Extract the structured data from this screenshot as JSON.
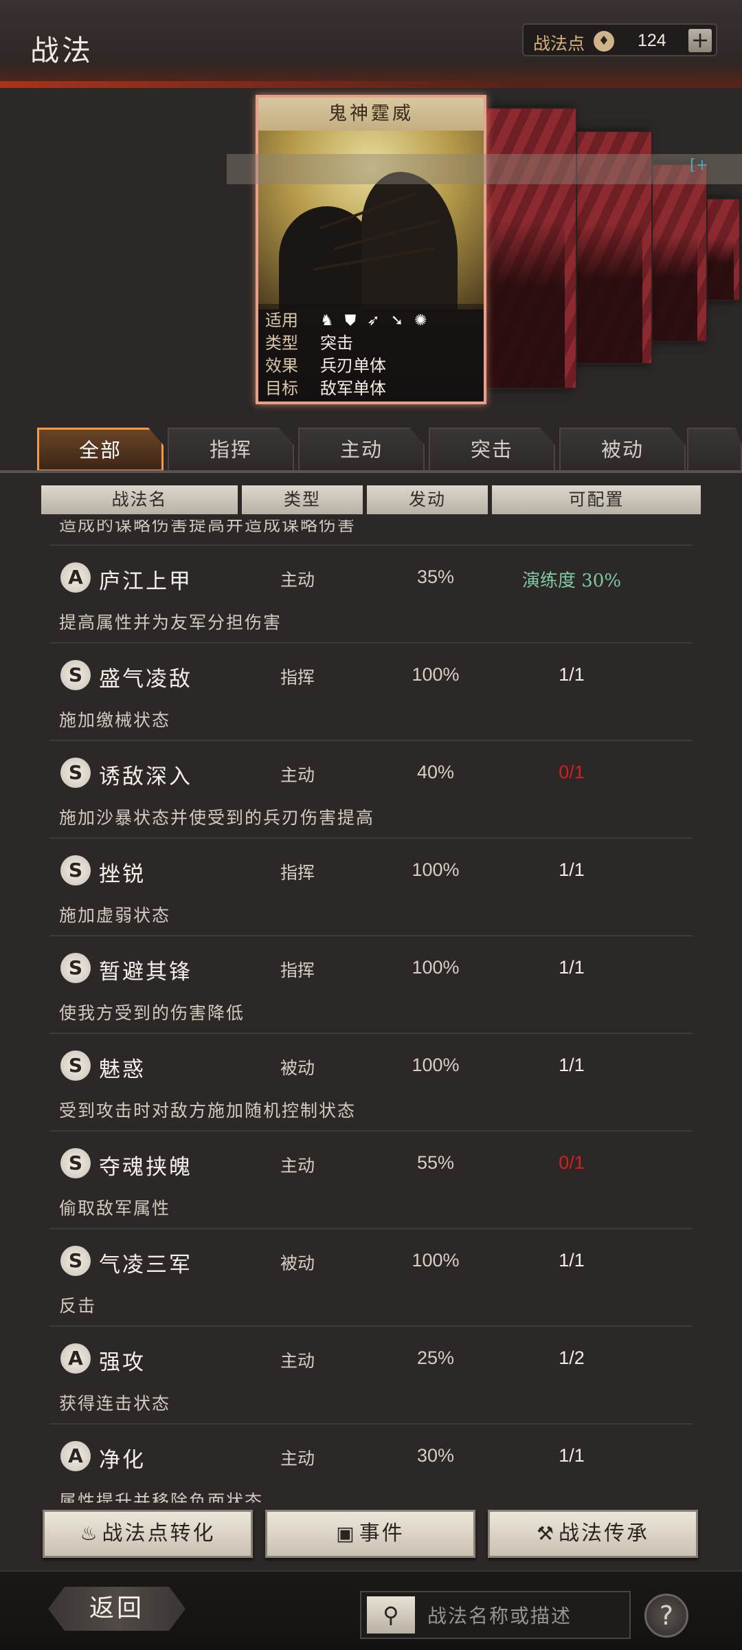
{
  "header": {
    "title": "战法",
    "points_label": "战法点",
    "points_value": "124",
    "plus_label": "+"
  },
  "card": {
    "name": "鬼神霆威",
    "rows": [
      {
        "key": "适用",
        "value": ""
      },
      {
        "key": "类型",
        "value": "突击"
      },
      {
        "key": "效果",
        "value": "兵刃单体"
      },
      {
        "key": "目标",
        "value": "敌军单体"
      }
    ],
    "troop_icons": [
      "cavalry-icon",
      "shield-icon",
      "bow-icon",
      "spear-icon",
      "siege-icon"
    ],
    "scroll_marker": "[+"
  },
  "tabs": [
    {
      "label": "全部",
      "active": true
    },
    {
      "label": "指挥",
      "active": false
    },
    {
      "label": "主动",
      "active": false
    },
    {
      "label": "突击",
      "active": false
    },
    {
      "label": "被动",
      "active": false
    }
  ],
  "columns": [
    "战法名",
    "类型",
    "发动",
    "可配置"
  ],
  "cut_text": "造成的谋略伤害提高并造成谋略伤害",
  "skills": [
    {
      "grade": "A",
      "name": "庐江上甲",
      "type": "主动",
      "rate": "35%",
      "config": "演练度 30%",
      "config_style": "green",
      "desc": "提高属性并为友军分担伤害"
    },
    {
      "grade": "S",
      "name": "盛气凌敌",
      "type": "指挥",
      "rate": "100%",
      "config": "1/1",
      "config_style": "normal",
      "desc": "施加缴械状态"
    },
    {
      "grade": "S",
      "name": "诱敌深入",
      "type": "主动",
      "rate": "40%",
      "config": "0/1",
      "config_style": "red",
      "desc": "施加沙暴状态并使受到的兵刃伤害提高"
    },
    {
      "grade": "S",
      "name": "挫锐",
      "type": "指挥",
      "rate": "100%",
      "config": "1/1",
      "config_style": "normal",
      "desc": "施加虚弱状态"
    },
    {
      "grade": "S",
      "name": "暂避其锋",
      "type": "指挥",
      "rate": "100%",
      "config": "1/1",
      "config_style": "normal",
      "desc": "使我方受到的伤害降低"
    },
    {
      "grade": "S",
      "name": "魅惑",
      "type": "被动",
      "rate": "100%",
      "config": "1/1",
      "config_style": "normal",
      "desc": "受到攻击时对敌方施加随机控制状态"
    },
    {
      "grade": "S",
      "name": "夺魂挟魄",
      "type": "主动",
      "rate": "55%",
      "config": "0/1",
      "config_style": "red",
      "desc": "偷取敌军属性"
    },
    {
      "grade": "S",
      "name": "气凌三军",
      "type": "被动",
      "rate": "100%",
      "config": "1/1",
      "config_style": "normal",
      "desc": "反击"
    },
    {
      "grade": "A",
      "name": "强攻",
      "type": "主动",
      "rate": "25%",
      "config": "1/2",
      "config_style": "normal",
      "desc": "获得连击状态"
    },
    {
      "grade": "A",
      "name": "净化",
      "type": "主动",
      "rate": "30%",
      "config": "1/1",
      "config_style": "normal",
      "desc": "属性提升并移除负面状态"
    }
  ],
  "bottom_buttons": [
    {
      "icon": "flame-icon",
      "label": "战法点转化"
    },
    {
      "icon": "event-icon",
      "label": "事件"
    },
    {
      "icon": "hammer-icon",
      "label": "战法传承"
    }
  ],
  "footer": {
    "back_label": "返回",
    "search_placeholder": "战法名称或描述",
    "help_label": "?"
  },
  "colors": {
    "accent_orange": "#f09a4a",
    "config_red": "#d42020",
    "config_green": "#7fc8a0",
    "header_red": "#a8321c"
  }
}
